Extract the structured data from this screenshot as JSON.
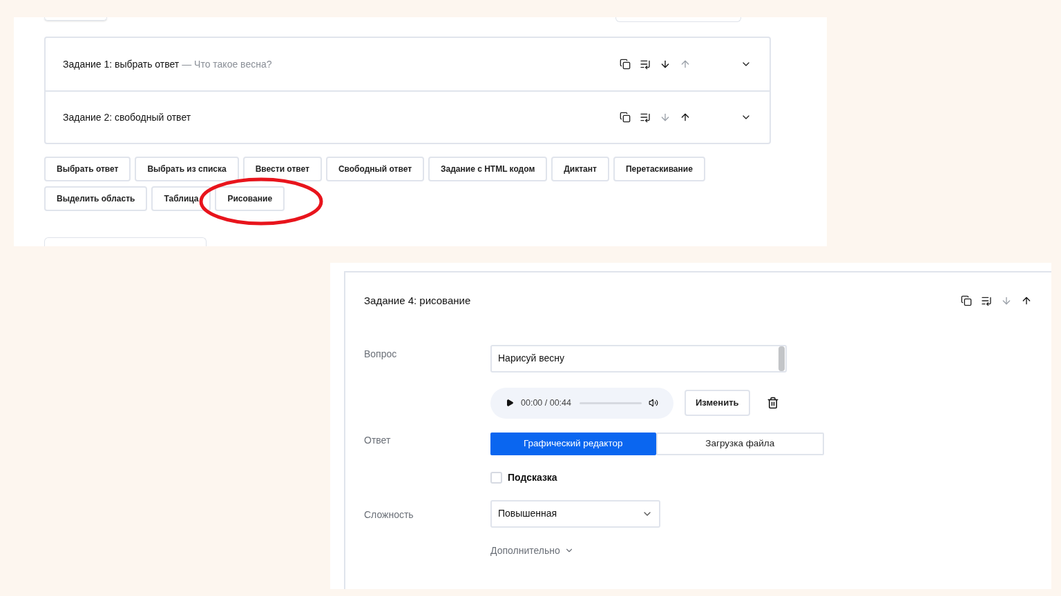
{
  "top_panel": {
    "tasks": [
      {
        "title": "Задание 1: выбрать ответ",
        "subtitle": "— Что такое весна?",
        "move_down_disabled": false,
        "move_up_disabled": true
      },
      {
        "title": "Задание 2: свободный ответ",
        "move_down_disabled": true,
        "move_up_disabled": false
      }
    ],
    "add_buttons": [
      {
        "label": "Выбрать ответ",
        "highlighted": false
      },
      {
        "label": "Выбрать из списка",
        "highlighted": false
      },
      {
        "label": "Ввести ответ",
        "highlighted": false
      },
      {
        "label": "Свободный ответ",
        "highlighted": false
      },
      {
        "label": "Задание с HTML кодом",
        "highlighted": false
      },
      {
        "label": "Диктант",
        "highlighted": false
      },
      {
        "label": "Перетаскивание",
        "highlighted": false
      },
      {
        "label": "Выделить область",
        "highlighted": false
      },
      {
        "label": "Таблица",
        "highlighted": false
      },
      {
        "label": "Рисование",
        "highlighted": true
      }
    ]
  },
  "task_editor": {
    "title": "Задание 4: рисование",
    "move_down_disabled": true,
    "move_up_disabled": false,
    "question_label": "Вопрос",
    "question_value": "Нарисуй весну",
    "audio": {
      "time": "00:00 / 00:44"
    },
    "change_button": "Изменить",
    "answer_label": "Ответ",
    "answer_modes": [
      {
        "label": "Графический редактор",
        "selected": true
      },
      {
        "label": "Загрузка файла",
        "selected": false
      }
    ],
    "hint": {
      "label": "Подсказка",
      "checked": false
    },
    "difficulty_label": "Сложность",
    "difficulty_value": "Повышенная",
    "more_link": "Дополнительно"
  }
}
